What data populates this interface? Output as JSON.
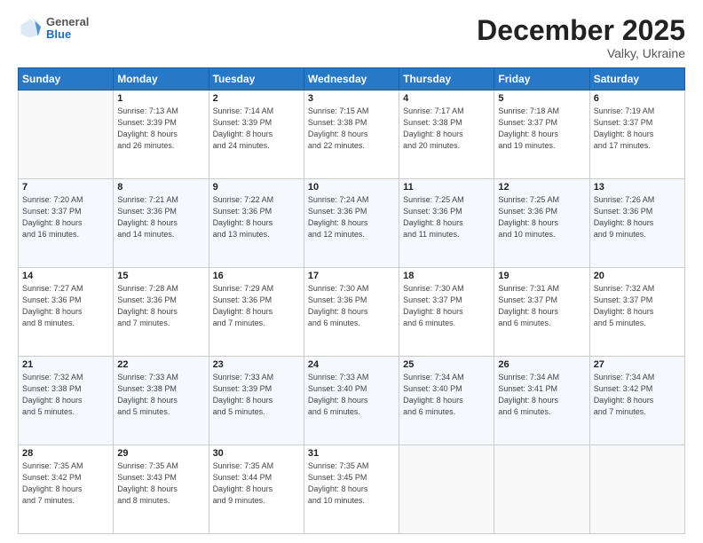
{
  "logo": {
    "general": "General",
    "blue": "Blue"
  },
  "header": {
    "month": "December 2025",
    "location": "Valky, Ukraine"
  },
  "weekdays": [
    "Sunday",
    "Monday",
    "Tuesday",
    "Wednesday",
    "Thursday",
    "Friday",
    "Saturday"
  ],
  "weeks": [
    [
      {
        "day": "",
        "info": ""
      },
      {
        "day": "1",
        "info": "Sunrise: 7:13 AM\nSunset: 3:39 PM\nDaylight: 8 hours\nand 26 minutes."
      },
      {
        "day": "2",
        "info": "Sunrise: 7:14 AM\nSunset: 3:39 PM\nDaylight: 8 hours\nand 24 minutes."
      },
      {
        "day": "3",
        "info": "Sunrise: 7:15 AM\nSunset: 3:38 PM\nDaylight: 8 hours\nand 22 minutes."
      },
      {
        "day": "4",
        "info": "Sunrise: 7:17 AM\nSunset: 3:38 PM\nDaylight: 8 hours\nand 20 minutes."
      },
      {
        "day": "5",
        "info": "Sunrise: 7:18 AM\nSunset: 3:37 PM\nDaylight: 8 hours\nand 19 minutes."
      },
      {
        "day": "6",
        "info": "Sunrise: 7:19 AM\nSunset: 3:37 PM\nDaylight: 8 hours\nand 17 minutes."
      }
    ],
    [
      {
        "day": "7",
        "info": "Sunrise: 7:20 AM\nSunset: 3:37 PM\nDaylight: 8 hours\nand 16 minutes."
      },
      {
        "day": "8",
        "info": "Sunrise: 7:21 AM\nSunset: 3:36 PM\nDaylight: 8 hours\nand 14 minutes."
      },
      {
        "day": "9",
        "info": "Sunrise: 7:22 AM\nSunset: 3:36 PM\nDaylight: 8 hours\nand 13 minutes."
      },
      {
        "day": "10",
        "info": "Sunrise: 7:24 AM\nSunset: 3:36 PM\nDaylight: 8 hours\nand 12 minutes."
      },
      {
        "day": "11",
        "info": "Sunrise: 7:25 AM\nSunset: 3:36 PM\nDaylight: 8 hours\nand 11 minutes."
      },
      {
        "day": "12",
        "info": "Sunrise: 7:25 AM\nSunset: 3:36 PM\nDaylight: 8 hours\nand 10 minutes."
      },
      {
        "day": "13",
        "info": "Sunrise: 7:26 AM\nSunset: 3:36 PM\nDaylight: 8 hours\nand 9 minutes."
      }
    ],
    [
      {
        "day": "14",
        "info": "Sunrise: 7:27 AM\nSunset: 3:36 PM\nDaylight: 8 hours\nand 8 minutes."
      },
      {
        "day": "15",
        "info": "Sunrise: 7:28 AM\nSunset: 3:36 PM\nDaylight: 8 hours\nand 7 minutes."
      },
      {
        "day": "16",
        "info": "Sunrise: 7:29 AM\nSunset: 3:36 PM\nDaylight: 8 hours\nand 7 minutes."
      },
      {
        "day": "17",
        "info": "Sunrise: 7:30 AM\nSunset: 3:36 PM\nDaylight: 8 hours\nand 6 minutes."
      },
      {
        "day": "18",
        "info": "Sunrise: 7:30 AM\nSunset: 3:37 PM\nDaylight: 8 hours\nand 6 minutes."
      },
      {
        "day": "19",
        "info": "Sunrise: 7:31 AM\nSunset: 3:37 PM\nDaylight: 8 hours\nand 6 minutes."
      },
      {
        "day": "20",
        "info": "Sunrise: 7:32 AM\nSunset: 3:37 PM\nDaylight: 8 hours\nand 5 minutes."
      }
    ],
    [
      {
        "day": "21",
        "info": "Sunrise: 7:32 AM\nSunset: 3:38 PM\nDaylight: 8 hours\nand 5 minutes."
      },
      {
        "day": "22",
        "info": "Sunrise: 7:33 AM\nSunset: 3:38 PM\nDaylight: 8 hours\nand 5 minutes."
      },
      {
        "day": "23",
        "info": "Sunrise: 7:33 AM\nSunset: 3:39 PM\nDaylight: 8 hours\nand 5 minutes."
      },
      {
        "day": "24",
        "info": "Sunrise: 7:33 AM\nSunset: 3:40 PM\nDaylight: 8 hours\nand 6 minutes."
      },
      {
        "day": "25",
        "info": "Sunrise: 7:34 AM\nSunset: 3:40 PM\nDaylight: 8 hours\nand 6 minutes."
      },
      {
        "day": "26",
        "info": "Sunrise: 7:34 AM\nSunset: 3:41 PM\nDaylight: 8 hours\nand 6 minutes."
      },
      {
        "day": "27",
        "info": "Sunrise: 7:34 AM\nSunset: 3:42 PM\nDaylight: 8 hours\nand 7 minutes."
      }
    ],
    [
      {
        "day": "28",
        "info": "Sunrise: 7:35 AM\nSunset: 3:42 PM\nDaylight: 8 hours\nand 7 minutes."
      },
      {
        "day": "29",
        "info": "Sunrise: 7:35 AM\nSunset: 3:43 PM\nDaylight: 8 hours\nand 8 minutes."
      },
      {
        "day": "30",
        "info": "Sunrise: 7:35 AM\nSunset: 3:44 PM\nDaylight: 8 hours\nand 9 minutes."
      },
      {
        "day": "31",
        "info": "Sunrise: 7:35 AM\nSunset: 3:45 PM\nDaylight: 8 hours\nand 10 minutes."
      },
      {
        "day": "",
        "info": ""
      },
      {
        "day": "",
        "info": ""
      },
      {
        "day": "",
        "info": ""
      }
    ]
  ]
}
